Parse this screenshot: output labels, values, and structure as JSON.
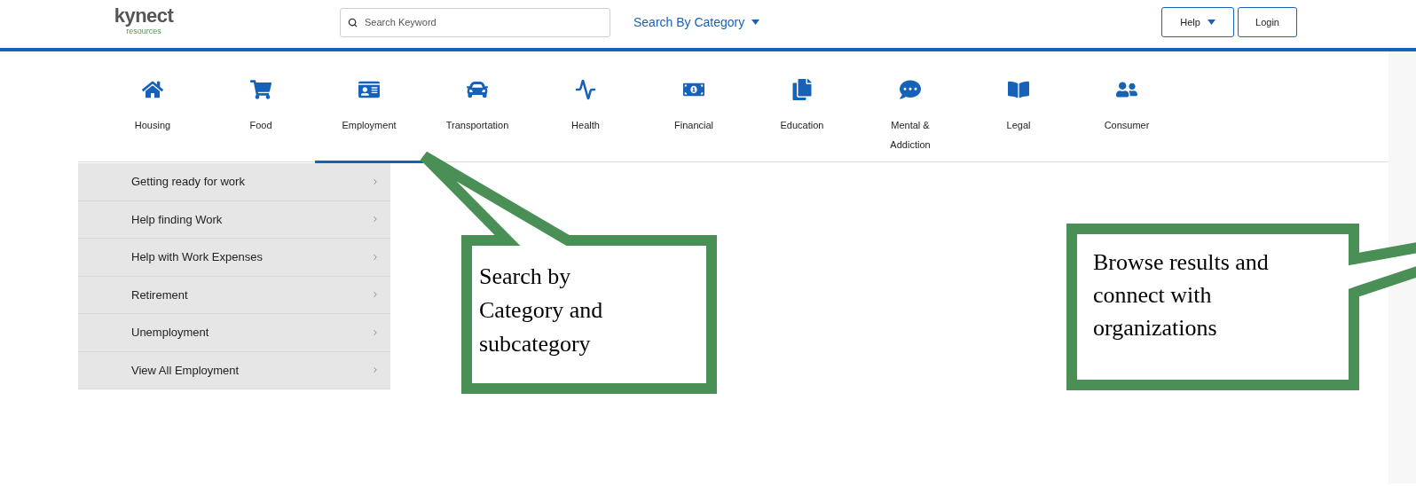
{
  "header": {
    "logo": {
      "name": "kynect",
      "tagline": "resources"
    },
    "search": {
      "placeholder": "Search Keyword"
    },
    "category_menu": "Search By Category",
    "buttons": [
      {
        "label": "Help",
        "dropdown": true
      },
      {
        "label": "Login",
        "dropdown": false
      }
    ]
  },
  "categories": [
    {
      "label": "Housing",
      "selected": false
    },
    {
      "label": "Food",
      "selected": false
    },
    {
      "label": "Employment",
      "selected": true
    },
    {
      "label": "Transportation",
      "selected": false
    },
    {
      "label": "Health",
      "selected": false
    },
    {
      "label": "Financial",
      "selected": false
    },
    {
      "label": "Education",
      "selected": false
    },
    {
      "label": "Mental &\nAddiction",
      "selected": false
    },
    {
      "label": "Legal",
      "selected": false
    },
    {
      "label": "Consumer",
      "selected": false
    }
  ],
  "submenu": {
    "items": [
      "Getting ready for work",
      "Help finding Work",
      "Help with Work Expenses",
      "Retirement",
      "Unemployment",
      "View All Employment"
    ]
  },
  "callouts": [
    {
      "text": "Search by\nCategory and\nsubcategory"
    },
    {
      "text": "Browse results and\nconnect with\norganizations"
    }
  ]
}
